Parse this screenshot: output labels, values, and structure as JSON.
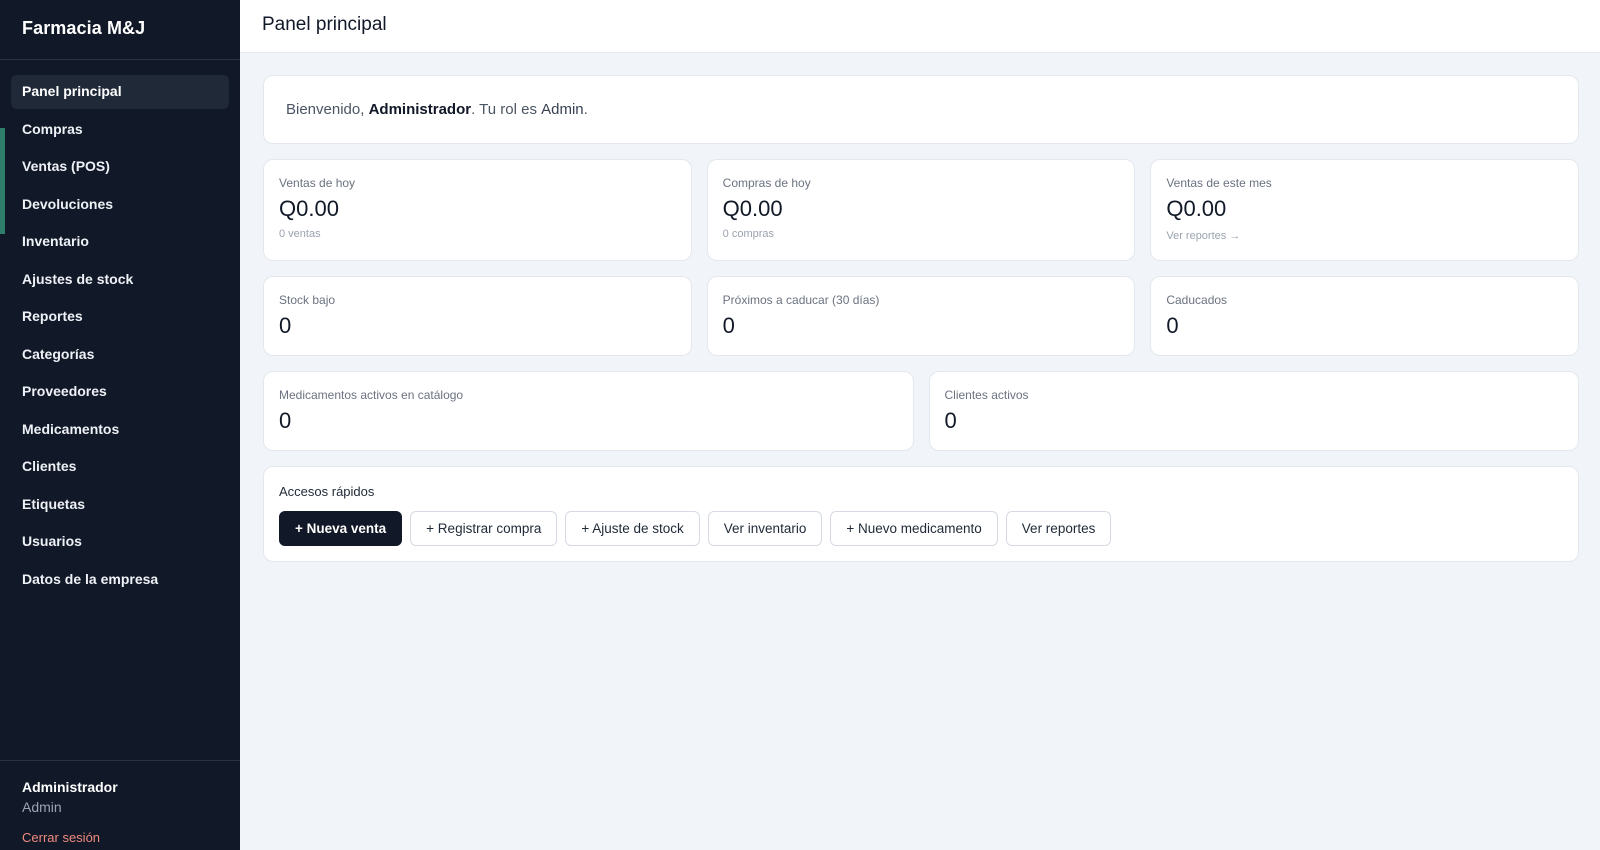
{
  "app": {
    "brand": "Farmacia M&J"
  },
  "sidebar": {
    "items": [
      {
        "label": "Panel principal"
      },
      {
        "label": "Compras"
      },
      {
        "label": "Ventas (POS)"
      },
      {
        "label": "Devoluciones"
      },
      {
        "label": "Inventario"
      },
      {
        "label": "Ajustes de stock"
      },
      {
        "label": "Reportes"
      },
      {
        "label": "Categorías"
      },
      {
        "label": "Proveedores"
      },
      {
        "label": "Medicamentos"
      },
      {
        "label": "Clientes"
      },
      {
        "label": "Etiquetas"
      },
      {
        "label": "Usuarios"
      },
      {
        "label": "Datos de la empresa"
      }
    ],
    "user": {
      "name": "Administrador",
      "role": "Admin",
      "logout": "Cerrar sesión"
    }
  },
  "header": {
    "title": "Panel principal"
  },
  "welcome": {
    "prefix": "Bienvenido, ",
    "user": "Administrador",
    "middle": ". Tu rol es ",
    "role": "Admin",
    "suffix": "."
  },
  "stats": {
    "sales_today": {
      "label": "Ventas de hoy",
      "value": "Q0.00",
      "sub": "0 ventas"
    },
    "purchases_today": {
      "label": "Compras de hoy",
      "value": "Q0.00",
      "sub": "0 compras"
    },
    "sales_month": {
      "label": "Ventas de este mes",
      "value": "Q0.00",
      "link": "Ver reportes →"
    },
    "low_stock": {
      "label": "Stock bajo",
      "value": "0"
    },
    "expiring": {
      "label": "Próximos a caducar (30 días)",
      "value": "0"
    },
    "expired": {
      "label": "Caducados",
      "value": "0"
    },
    "active_meds": {
      "label": "Medicamentos activos en catálogo",
      "value": "0"
    },
    "active_clients": {
      "label": "Clientes activos",
      "value": "0"
    }
  },
  "quick_access": {
    "title": "Accesos rápidos",
    "buttons": [
      {
        "label": "+ Nueva venta"
      },
      {
        "label": "+ Registrar compra"
      },
      {
        "label": "+ Ajuste de stock"
      },
      {
        "label": "Ver inventario"
      },
      {
        "label": "+ Nuevo medicamento"
      },
      {
        "label": "Ver reportes"
      }
    ]
  },
  "colors": {
    "sidebar_bg": "#111827",
    "accent_bar": "#2f7d6b",
    "logout": "#f08a7e",
    "page_bg": "#f1f4f9"
  }
}
